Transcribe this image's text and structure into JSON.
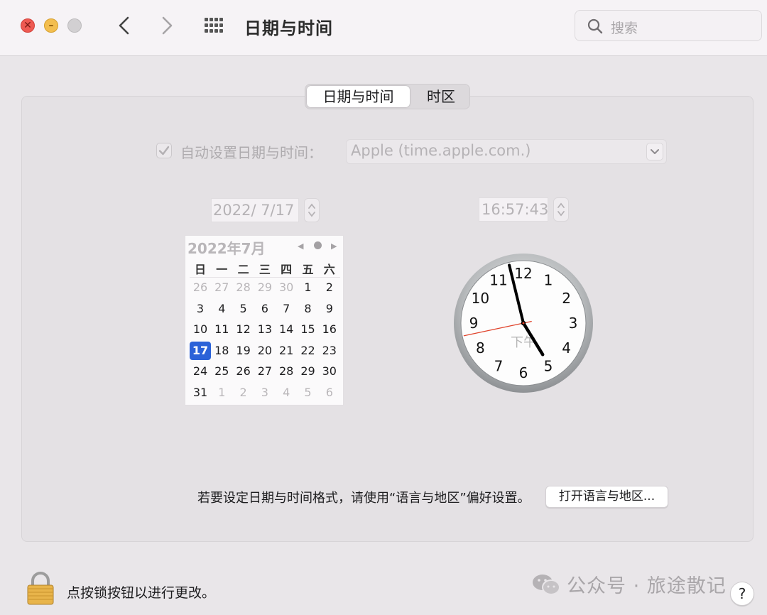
{
  "window": {
    "title": "日期与时间",
    "search_placeholder": "搜索",
    "close_glyph": "✕",
    "minimize_glyph": "–"
  },
  "tabs": [
    {
      "label": "日期与时间",
      "active": true
    },
    {
      "label": "时区",
      "active": false
    }
  ],
  "auto_set": {
    "label": "自动设置日期与时间：",
    "checked": true,
    "server": "Apple (time.apple.com.)"
  },
  "date_field": "2022/  7/17",
  "time_field": "16:57:43",
  "calendar": {
    "title": "2022年7月",
    "weekdays": [
      "日",
      "一",
      "二",
      "三",
      "四",
      "五",
      "六"
    ],
    "weeks": [
      [
        {
          "d": "26",
          "m": true
        },
        {
          "d": "27",
          "m": true
        },
        {
          "d": "28",
          "m": true
        },
        {
          "d": "29",
          "m": true
        },
        {
          "d": "30",
          "m": true
        },
        {
          "d": "1"
        },
        {
          "d": "2"
        }
      ],
      [
        {
          "d": "3"
        },
        {
          "d": "4"
        },
        {
          "d": "5"
        },
        {
          "d": "6"
        },
        {
          "d": "7"
        },
        {
          "d": "8"
        },
        {
          "d": "9"
        }
      ],
      [
        {
          "d": "10"
        },
        {
          "d": "11"
        },
        {
          "d": "12"
        },
        {
          "d": "13"
        },
        {
          "d": "14"
        },
        {
          "d": "15"
        },
        {
          "d": "16"
        }
      ],
      [
        {
          "d": "17",
          "s": true
        },
        {
          "d": "18"
        },
        {
          "d": "19"
        },
        {
          "d": "20"
        },
        {
          "d": "21"
        },
        {
          "d": "22"
        },
        {
          "d": "23"
        }
      ],
      [
        {
          "d": "24"
        },
        {
          "d": "25"
        },
        {
          "d": "26"
        },
        {
          "d": "27"
        },
        {
          "d": "28"
        },
        {
          "d": "29"
        },
        {
          "d": "30"
        }
      ],
      [
        {
          "d": "31"
        },
        {
          "d": "1",
          "m": true
        },
        {
          "d": "2",
          "m": true
        },
        {
          "d": "3",
          "m": true
        },
        {
          "d": "4",
          "m": true
        },
        {
          "d": "5",
          "m": true
        },
        {
          "d": "6",
          "m": true
        }
      ]
    ],
    "selected_color": "#2b62d8"
  },
  "clock": {
    "numbers": [
      "12",
      "1",
      "2",
      "3",
      "4",
      "5",
      "6",
      "7",
      "8",
      "9",
      "10",
      "11"
    ],
    "ampm": "下午",
    "hours": 16,
    "minutes": 57,
    "seconds": 43,
    "second_hand_color": "#e0442c"
  },
  "format_hint": "若要设定日期与时间格式，请使用“语言与地区”偏好设置。",
  "open_lang_button": "打开语言与地区...",
  "lock_hint": "点按锁按钮以进行更改。",
  "watermark": "公众号 · 旅途散记",
  "help_label": "?"
}
